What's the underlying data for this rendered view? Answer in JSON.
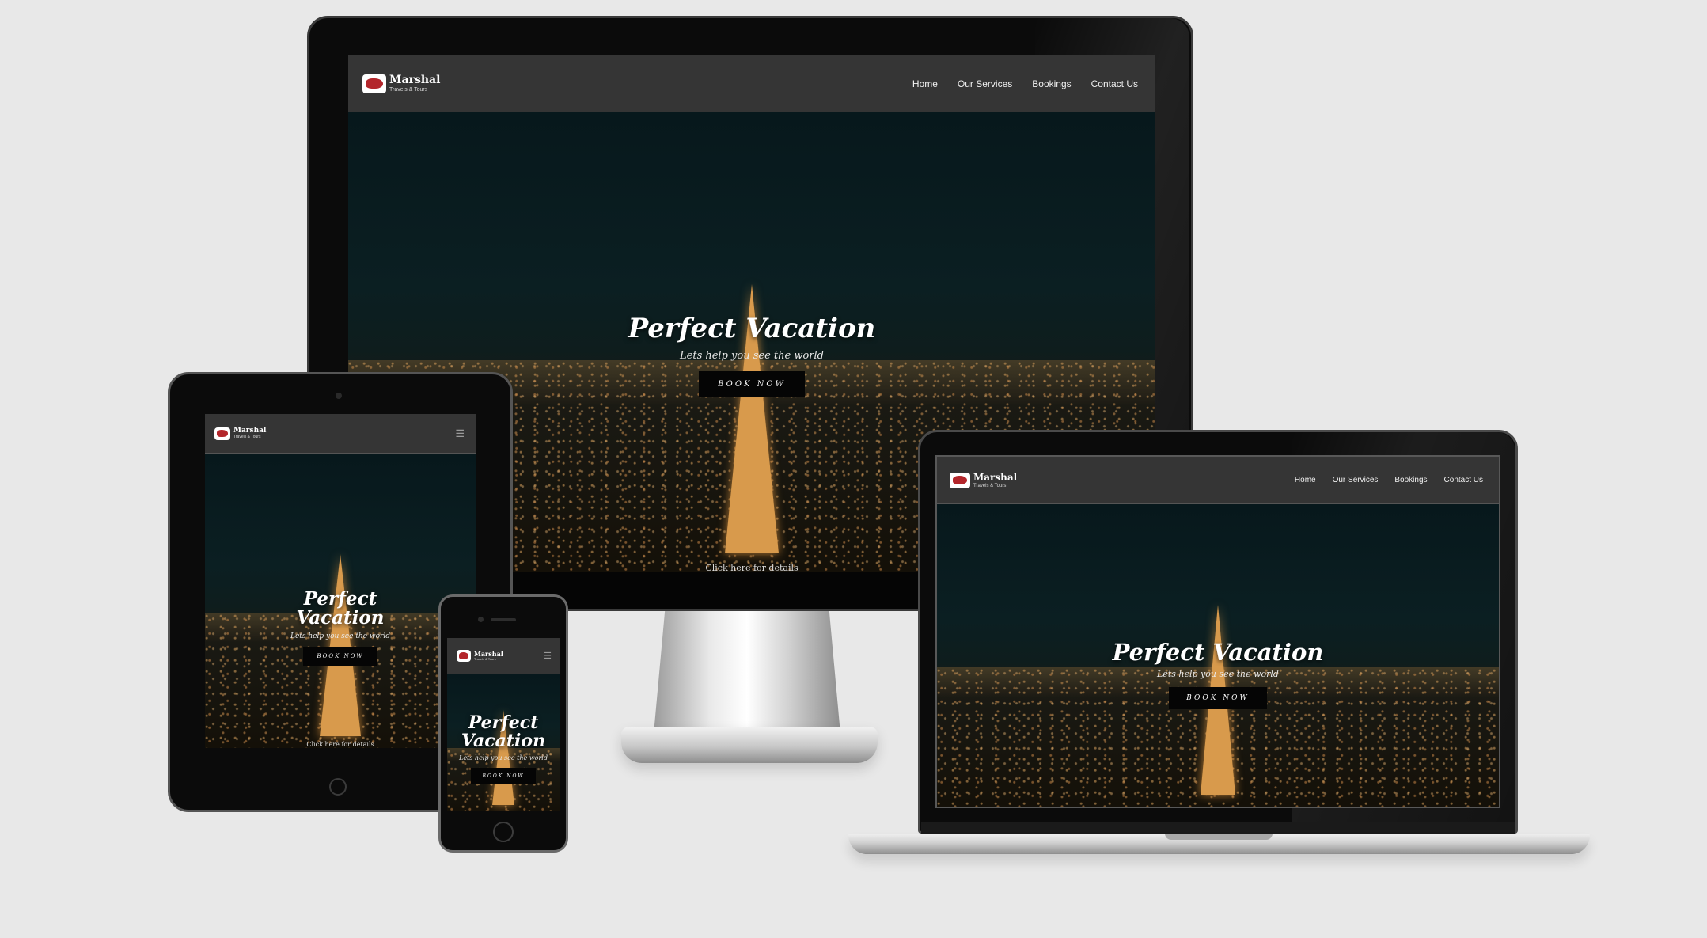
{
  "brand": {
    "name": "Marshal",
    "tagline": "Travels & Tours"
  },
  "nav": {
    "links": [
      "Home",
      "Our Services",
      "Bookings",
      "Contact Us"
    ]
  },
  "hero": {
    "title": "Perfect Vacation",
    "title_line1": "Perfect",
    "title_line2": "Vacation",
    "subtitle": "Lets help you see the world",
    "cta": "BOOK NOW",
    "details_link": "Click here for details"
  },
  "icons": {
    "menu": "hamburger-menu-icon",
    "logo": "logo-icon"
  }
}
